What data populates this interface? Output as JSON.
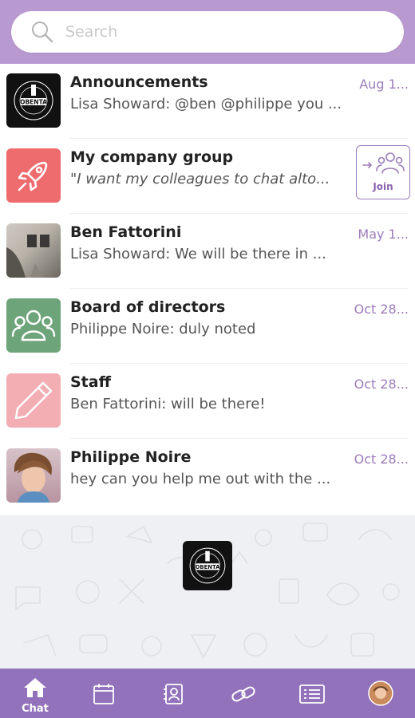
{
  "search": {
    "placeholder": "Search"
  },
  "chats": [
    {
      "title": "Announcements",
      "preview": "Lisa Showard: @ben @philippe you ...",
      "date": "Aug 1..."
    },
    {
      "title": "My company group",
      "preview": "\"I want my colleagues to chat alto...",
      "action": "Join"
    },
    {
      "title": "Ben Fattorini",
      "preview": "Lisa Showard: We will be there in ...",
      "date": "May 1..."
    },
    {
      "title": "Board of directors",
      "preview": "Philippe Noire: duly noted",
      "date": "Oct 28..."
    },
    {
      "title": "Staff",
      "preview": "Ben Fattorini: will be there!",
      "date": "Oct 28..."
    },
    {
      "title": "Philippe Noire",
      "preview": "hey can you help me out with the ...",
      "date": "Oct 28..."
    }
  ],
  "logo_text": "OBENTA",
  "tabs": [
    {
      "label": "Chat",
      "icon": "home-icon",
      "active": true
    },
    {
      "icon": "calendar-icon"
    },
    {
      "icon": "contacts-icon"
    },
    {
      "icon": "link-icon"
    },
    {
      "icon": "list-icon"
    },
    {
      "icon": "profile-avatar"
    }
  ],
  "colors": {
    "header": "#b89ad0",
    "accent": "#9272bb",
    "date": "#9b7cbb",
    "announcements_bg": "#111111",
    "company_group_bg": "#ee6b6e",
    "board_bg": "#6ea47a",
    "staff_bg": "#f3aeb4"
  }
}
